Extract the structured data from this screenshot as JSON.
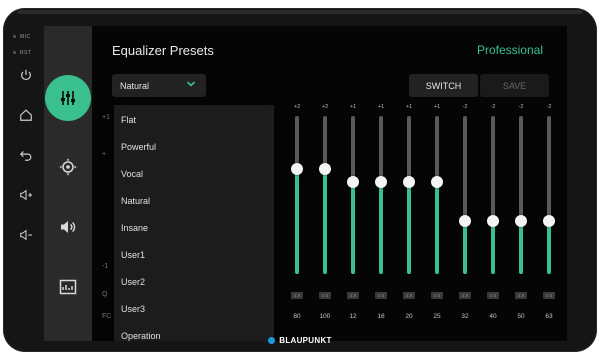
{
  "device": {
    "mic_label": "MIC",
    "rst_label": "RST",
    "brand": "BLAUPUNKT"
  },
  "hardware_buttons": [
    {
      "name": "power-icon"
    },
    {
      "name": "home-icon"
    },
    {
      "name": "back-icon"
    },
    {
      "name": "volume-up-icon",
      "label": "◁+"
    },
    {
      "name": "volume-down-icon",
      "label": "◁−"
    }
  ],
  "sidebar": {
    "items": [
      {
        "name": "equalizer-icon",
        "active": true
      },
      {
        "name": "balance-fader-icon",
        "active": false
      },
      {
        "name": "speaker-icon",
        "active": false
      },
      {
        "name": "subwoofer-icon",
        "active": false
      }
    ]
  },
  "header": {
    "title": "Equalizer Presets",
    "mode": "Professional"
  },
  "toolbar": {
    "preset_value": "Natural",
    "switch_label": "SWITCH",
    "save_label": "SAVE"
  },
  "left_scale": {
    "top": "+1",
    "mid": "+",
    "bottom": "-1",
    "row_q": "Q",
    "row_fc": "FC"
  },
  "dropdown": {
    "items": [
      "Flat",
      "Powerful",
      "Vocal",
      "Natural",
      "Insane",
      "User1",
      "User2",
      "User3",
      "Operation"
    ]
  },
  "bands": [
    {
      "freq": "80",
      "gain": "+2",
      "q": "2.0",
      "level": 2
    },
    {
      "freq": "100",
      "gain": "+2",
      "q": "2.0",
      "level": 2
    },
    {
      "freq": "12",
      "gain": "+1",
      "q": "2.0",
      "level": 1
    },
    {
      "freq": "16",
      "gain": "+1",
      "q": "2.0",
      "level": 1
    },
    {
      "freq": "20",
      "gain": "+1",
      "q": "2.0",
      "level": 1
    },
    {
      "freq": "25",
      "gain": "+1",
      "q": "2.0",
      "level": 1
    },
    {
      "freq": "32",
      "gain": "-2",
      "q": "2.0",
      "level": -2
    },
    {
      "freq": "40",
      "gain": "-2",
      "q": "2.0",
      "level": -2
    },
    {
      "freq": "50",
      "gain": "-2",
      "q": "2.0",
      "level": -2
    },
    {
      "freq": "63",
      "gain": "-2",
      "q": "2.0",
      "level": -2
    }
  ],
  "colors": {
    "accent": "#3ac08e",
    "brand_dot": "#1a9be0"
  }
}
